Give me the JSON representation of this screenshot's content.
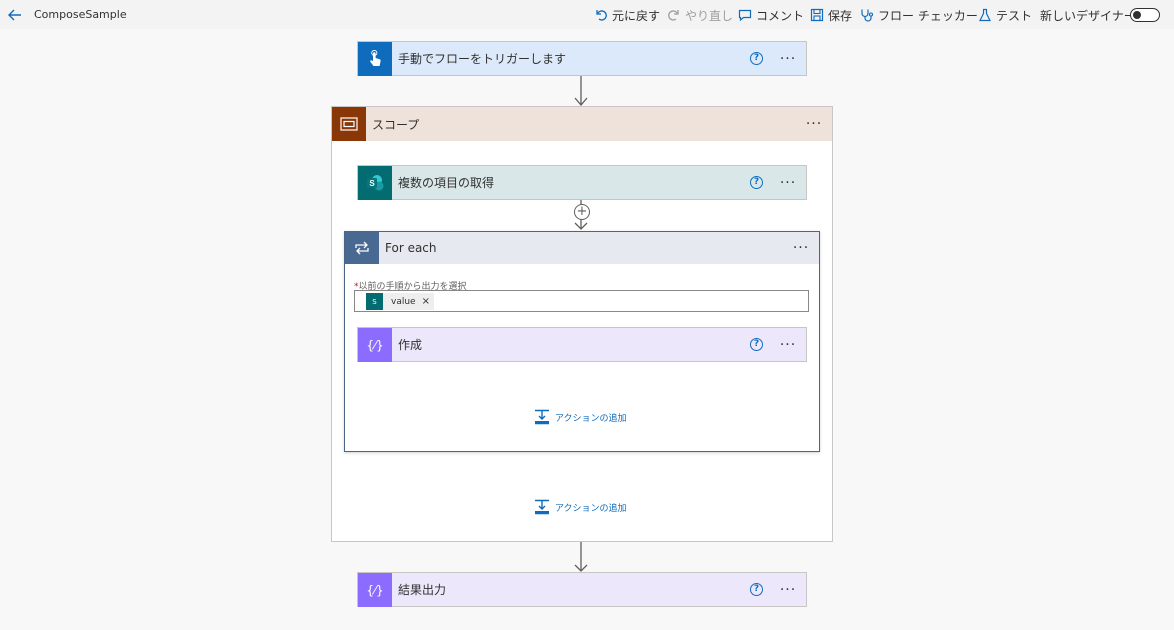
{
  "app": {
    "title": "ComposeSample"
  },
  "toolbar": {
    "undo": "元に戻す",
    "redo": "やり直し",
    "comment": "コメント",
    "save": "保存",
    "flow_checker": "フロー チェッカー",
    "test": "テスト",
    "new_designer": "新しいデザイナー"
  },
  "trigger": {
    "title": "手動でフローをトリガーします",
    "color": "#0f6cbd"
  },
  "scope": {
    "title": "スコープ",
    "color": "#8a3707"
  },
  "get_items": {
    "title": "複数の項目の取得",
    "color": "#036c70"
  },
  "foreach": {
    "title": "For each",
    "color": "#486991",
    "field_label": "以前の手順から出力を選択",
    "token_value": "value",
    "token_icon": "S"
  },
  "compose": {
    "title": "作成",
    "color": "#8c6cff"
  },
  "add_action_inner": "アクションの追加",
  "add_action_scope": "アクションの追加",
  "result": {
    "title": "結果出力",
    "color": "#8c6cff"
  },
  "icons": {
    "back": "arrow-left-icon",
    "help": "?",
    "more": "···",
    "plus": "+",
    "close": "×"
  }
}
